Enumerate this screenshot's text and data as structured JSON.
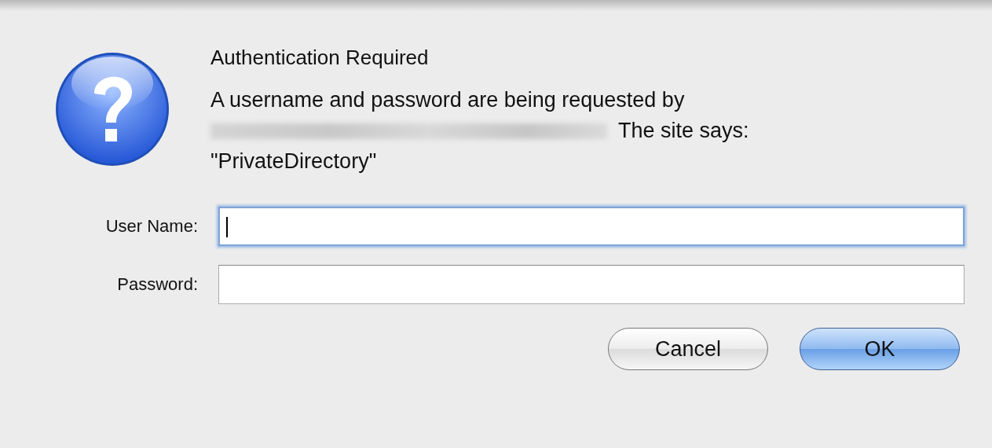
{
  "dialog": {
    "title": "Authentication Required",
    "message": {
      "before": "A username and password are being requested by",
      "after": "The site says:",
      "realm": "\"PrivateDirectory\""
    },
    "fields": [
      {
        "label": "User Name:",
        "focused": true
      },
      {
        "label": "Password:",
        "focused": false
      }
    ],
    "buttons": [
      {
        "label": "Cancel",
        "default": false
      },
      {
        "label": "OK",
        "default": true
      }
    ]
  }
}
